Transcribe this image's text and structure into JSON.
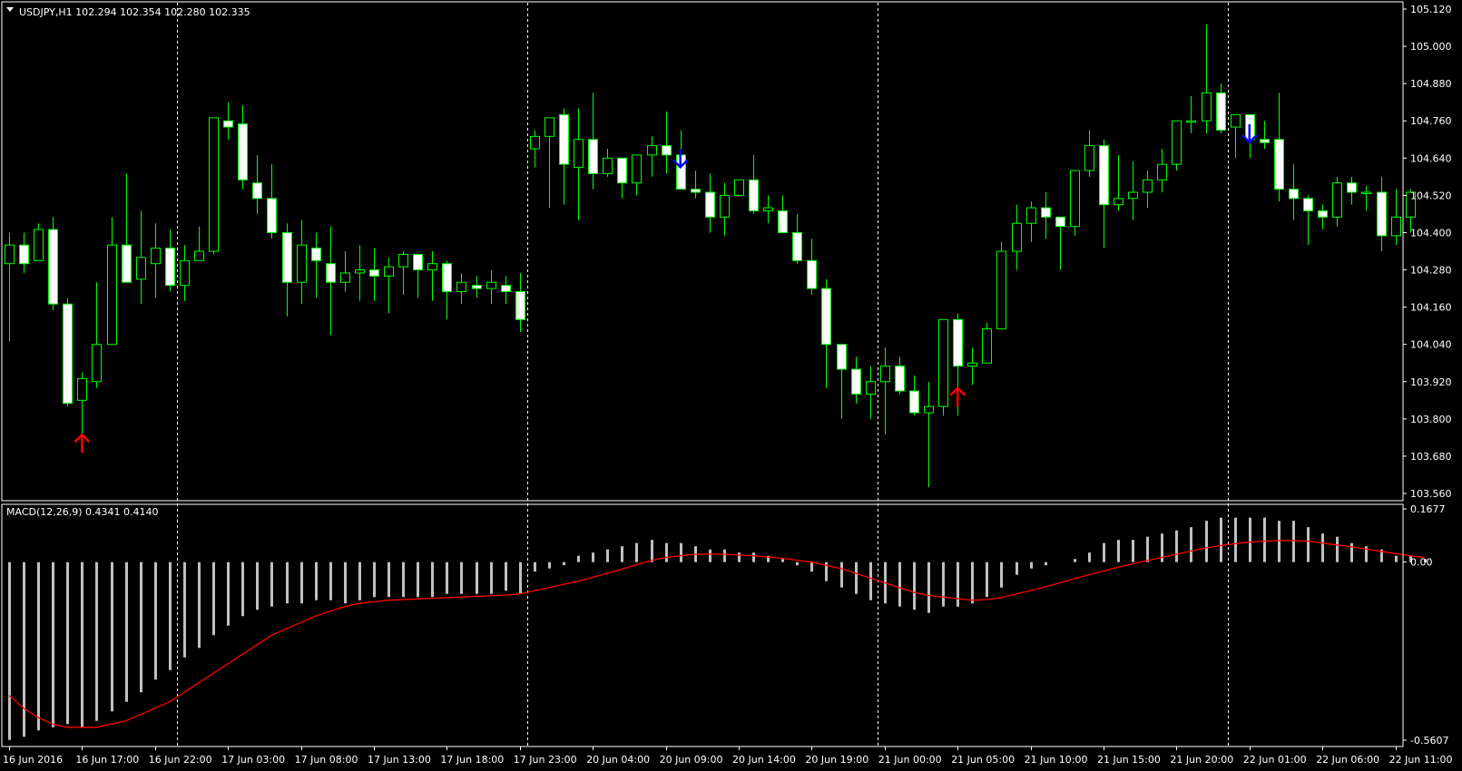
{
  "colors": {
    "background": "#000000",
    "frame": "#ffffff",
    "bull_body": "#000000",
    "bear_body": "#ffffff",
    "candle_outline": "#00ff00",
    "wick": "#00ff00",
    "macd_hist": "#c0c0c0",
    "signal_line": "#ff0000",
    "buy_arrow": "#ff0000",
    "sell_arrow": "#0000ff",
    "separator": "#ffffff"
  },
  "header": {
    "symbol_info": "USDJPY,H1  102.294 102.354 102.280 102.335",
    "macd_info": "MACD(12,26,9) 0.4341 0.4140"
  },
  "chart_data": [
    {
      "type": "candlestick",
      "title": "USDJPY,H1",
      "ylim": [
        103.56,
        105.12
      ],
      "y_ticks": [
        "105.120",
        "105.000",
        "104.880",
        "104.760",
        "104.640",
        "104.520",
        "104.400",
        "104.280",
        "104.160",
        "104.040",
        "103.920",
        "103.800",
        "103.680",
        "103.560"
      ],
      "x_ticks": [
        "16 Jun 2016",
        "16 Jun 17:00",
        "16 Jun 22:00",
        "17 Jun 03:00",
        "17 Jun 08:00",
        "17 Jun 13:00",
        "17 Jun 18:00",
        "17 Jun 23:00",
        "20 Jun 04:00",
        "20 Jun 09:00",
        "20 Jun 14:00",
        "20 Jun 19:00",
        "21 Jun 00:00",
        "21 Jun 05:00",
        "21 Jun 10:00",
        "21 Jun 15:00",
        "21 Jun 20:00",
        "22 Jun 01:00",
        "22 Jun 06:00",
        "22 Jun 11:00"
      ],
      "session_separators": [
        12,
        36,
        60,
        84
      ],
      "candles": [
        [
          104.3,
          104.4,
          104.05,
          104.36
        ],
        [
          104.36,
          104.4,
          104.27,
          104.3
        ],
        [
          104.31,
          104.43,
          104.31,
          104.41
        ],
        [
          104.41,
          104.45,
          104.15,
          104.17
        ],
        [
          104.17,
          104.19,
          103.84,
          103.85
        ],
        [
          103.86,
          103.95,
          103.75,
          103.93
        ],
        [
          103.92,
          104.24,
          103.9,
          104.04
        ],
        [
          104.04,
          104.45,
          104.04,
          104.36
        ],
        [
          104.36,
          104.59,
          104.25,
          104.24
        ],
        [
          104.25,
          104.47,
          104.17,
          104.32
        ],
        [
          104.3,
          104.43,
          104.19,
          104.35
        ],
        [
          104.35,
          104.41,
          104.21,
          104.23
        ],
        [
          104.23,
          104.36,
          104.18,
          104.31
        ],
        [
          104.31,
          104.42,
          104.31,
          104.34
        ],
        [
          104.34,
          104.77,
          104.33,
          104.77
        ],
        [
          104.76,
          104.82,
          104.7,
          104.74
        ],
        [
          104.75,
          104.81,
          104.54,
          104.57
        ],
        [
          104.56,
          104.65,
          104.46,
          104.51
        ],
        [
          104.51,
          104.62,
          104.38,
          104.4
        ],
        [
          104.4,
          104.43,
          104.13,
          104.24
        ],
        [
          104.24,
          104.44,
          104.17,
          104.36
        ],
        [
          104.35,
          104.4,
          104.19,
          104.31
        ],
        [
          104.3,
          104.42,
          104.07,
          104.24
        ],
        [
          104.24,
          104.34,
          104.21,
          104.27
        ],
        [
          104.27,
          104.36,
          104.18,
          104.28
        ],
        [
          104.28,
          104.35,
          104.18,
          104.26
        ],
        [
          104.26,
          104.32,
          104.14,
          104.29
        ],
        [
          104.29,
          104.34,
          104.2,
          104.33
        ],
        [
          104.33,
          104.31,
          104.19,
          104.28
        ],
        [
          104.28,
          104.34,
          104.18,
          104.3
        ],
        [
          104.3,
          104.31,
          104.12,
          104.21
        ],
        [
          104.21,
          104.27,
          104.17,
          104.24
        ],
        [
          104.23,
          104.26,
          104.19,
          104.22
        ],
        [
          104.22,
          104.28,
          104.17,
          104.24
        ],
        [
          104.23,
          104.26,
          104.17,
          104.21
        ],
        [
          104.21,
          104.27,
          104.08,
          104.12
        ],
        [
          104.67,
          104.73,
          104.61,
          104.71
        ],
        [
          104.71,
          104.77,
          104.48,
          104.77
        ],
        [
          104.78,
          104.8,
          104.49,
          104.62
        ],
        [
          104.61,
          104.8,
          104.44,
          104.7
        ],
        [
          104.7,
          104.85,
          104.54,
          104.59
        ],
        [
          104.59,
          104.67,
          104.58,
          104.64
        ],
        [
          104.64,
          104.63,
          104.51,
          104.56
        ],
        [
          104.56,
          104.62,
          104.52,
          104.65
        ],
        [
          104.65,
          104.71,
          104.58,
          104.68
        ],
        [
          104.68,
          104.79,
          104.59,
          104.65
        ],
        [
          104.65,
          104.73,
          104.54,
          104.54
        ],
        [
          104.54,
          104.6,
          104.51,
          104.53
        ],
        [
          104.53,
          104.59,
          104.4,
          104.45
        ],
        [
          104.45,
          104.56,
          104.39,
          104.52
        ],
        [
          104.52,
          104.57,
          104.54,
          104.57
        ],
        [
          104.57,
          104.65,
          104.46,
          104.47
        ],
        [
          104.47,
          104.52,
          104.43,
          104.48
        ],
        [
          104.47,
          104.52,
          104.4,
          104.4
        ],
        [
          104.4,
          104.46,
          104.3,
          104.31
        ],
        [
          104.31,
          104.38,
          104.2,
          104.22
        ],
        [
          104.22,
          104.25,
          103.9,
          104.04
        ],
        [
          104.04,
          104.03,
          103.8,
          103.96
        ],
        [
          103.96,
          104.0,
          103.85,
          103.88
        ],
        [
          103.88,
          103.97,
          103.8,
          103.92
        ],
        [
          103.92,
          104.03,
          103.75,
          103.97
        ],
        [
          103.97,
          104.0,
          103.88,
          103.89
        ],
        [
          103.89,
          103.94,
          103.81,
          103.82
        ],
        [
          103.82,
          103.92,
          103.58,
          103.84
        ],
        [
          103.84,
          104.12,
          103.81,
          104.12
        ],
        [
          104.12,
          104.14,
          103.81,
          103.97
        ],
        [
          103.97,
          104.03,
          103.91,
          103.98
        ],
        [
          103.98,
          104.11,
          103.98,
          104.09
        ],
        [
          104.09,
          104.37,
          104.11,
          104.34
        ],
        [
          104.34,
          104.49,
          104.28,
          104.43
        ],
        [
          104.43,
          104.5,
          104.37,
          104.48
        ],
        [
          104.48,
          104.53,
          104.38,
          104.45
        ],
        [
          104.45,
          104.44,
          104.28,
          104.42
        ],
        [
          104.42,
          104.6,
          104.39,
          104.6
        ],
        [
          104.6,
          104.73,
          104.58,
          104.68
        ],
        [
          104.68,
          104.7,
          104.35,
          104.49
        ],
        [
          104.49,
          104.65,
          104.47,
          104.51
        ],
        [
          104.51,
          104.63,
          104.44,
          104.53
        ],
        [
          104.53,
          104.6,
          104.48,
          104.57
        ],
        [
          104.57,
          104.67,
          104.53,
          104.62
        ],
        [
          104.62,
          104.75,
          104.6,
          104.76
        ],
        [
          104.76,
          104.84,
          104.72,
          104.76
        ],
        [
          104.76,
          105.07,
          104.72,
          104.85
        ],
        [
          104.85,
          104.88,
          104.72,
          104.73
        ],
        [
          104.74,
          104.77,
          104.64,
          104.78
        ],
        [
          104.78,
          104.78,
          104.64,
          104.7
        ],
        [
          104.7,
          104.76,
          104.67,
          104.69
        ],
        [
          104.7,
          104.85,
          104.5,
          104.54
        ],
        [
          104.54,
          104.62,
          104.44,
          104.51
        ],
        [
          104.51,
          104.52,
          104.36,
          104.47
        ],
        [
          104.47,
          104.49,
          104.41,
          104.45
        ],
        [
          104.45,
          104.58,
          104.42,
          104.56
        ],
        [
          104.56,
          104.58,
          104.49,
          104.53
        ],
        [
          104.53,
          104.55,
          104.47,
          104.53
        ],
        [
          104.53,
          104.58,
          104.34,
          104.39
        ],
        [
          104.39,
          104.54,
          104.36,
          104.45
        ],
        [
          104.45,
          104.54,
          104.4,
          104.53
        ]
      ],
      "annotations": [
        {
          "type": "buy-arrow",
          "index": 5,
          "price": 103.72
        },
        {
          "type": "sell-arrow",
          "index": 46,
          "price": 104.64
        },
        {
          "type": "buy-arrow",
          "index": 65,
          "price": 103.87
        },
        {
          "type": "sell-arrow",
          "index": 85,
          "price": 104.72
        }
      ]
    },
    {
      "type": "bar",
      "title": "MACD(12,26,9) 0.4341 0.4140",
      "ylim": [
        -0.5607,
        0.1677
      ],
      "y_ticks": [
        "0.1677",
        "0.00",
        "-0.5607"
      ],
      "histogram": [
        -0.56,
        -0.55,
        -0.53,
        -0.52,
        -0.51,
        -0.52,
        -0.5,
        -0.47,
        -0.44,
        -0.41,
        -0.37,
        -0.34,
        -0.3,
        -0.27,
        -0.23,
        -0.2,
        -0.17,
        -0.15,
        -0.14,
        -0.13,
        -0.13,
        -0.12,
        -0.12,
        -0.13,
        -0.12,
        -0.11,
        -0.11,
        -0.11,
        -0.11,
        -0.11,
        -0.1,
        -0.1,
        -0.1,
        -0.1,
        -0.09,
        -0.1,
        -0.03,
        -0.02,
        -0.01,
        0.02,
        0.03,
        0.04,
        0.05,
        0.06,
        0.07,
        0.06,
        0.06,
        0.05,
        0.04,
        0.04,
        0.03,
        0.03,
        0.02,
        0.01,
        -0.01,
        -0.03,
        -0.06,
        -0.08,
        -0.1,
        -0.12,
        -0.13,
        -0.14,
        -0.15,
        -0.16,
        -0.14,
        -0.14,
        -0.13,
        -0.11,
        -0.08,
        -0.04,
        -0.02,
        -0.01,
        0.0,
        0.01,
        0.03,
        0.06,
        0.07,
        0.07,
        0.08,
        0.09,
        0.1,
        0.11,
        0.13,
        0.14,
        0.14,
        0.14,
        0.14,
        0.13,
        0.13,
        0.11,
        0.09,
        0.08,
        0.06,
        0.05,
        0.04,
        0.02,
        0.02,
        0.01
      ],
      "signal": [
        -0.42,
        -0.46,
        -0.49,
        -0.51,
        -0.52,
        -0.52,
        -0.52,
        -0.51,
        -0.5,
        -0.48,
        -0.46,
        -0.44,
        -0.41,
        -0.38,
        -0.35,
        -0.32,
        -0.29,
        -0.26,
        -0.23,
        -0.21,
        -0.19,
        -0.17,
        -0.155,
        -0.14,
        -0.13,
        -0.125,
        -0.12,
        -0.118,
        -0.116,
        -0.114,
        -0.112,
        -0.11,
        -0.108,
        -0.106,
        -0.104,
        -0.1,
        -0.09,
        -0.08,
        -0.07,
        -0.06,
        -0.048,
        -0.035,
        -0.022,
        -0.008,
        0.005,
        0.015,
        0.02,
        0.025,
        0.025,
        0.025,
        0.022,
        0.02,
        0.016,
        0.012,
        0.006,
        0.0,
        -0.01,
        -0.02,
        -0.035,
        -0.05,
        -0.065,
        -0.08,
        -0.095,
        -0.105,
        -0.11,
        -0.115,
        -0.12,
        -0.118,
        -0.112,
        -0.1,
        -0.09,
        -0.078,
        -0.065,
        -0.052,
        -0.04,
        -0.028,
        -0.016,
        -0.005,
        0.005,
        0.015,
        0.025,
        0.035,
        0.045,
        0.052,
        0.058,
        0.063,
        0.066,
        0.068,
        0.068,
        0.066,
        0.06,
        0.054,
        0.048,
        0.041,
        0.034,
        0.027,
        0.02,
        0.015
      ]
    }
  ]
}
